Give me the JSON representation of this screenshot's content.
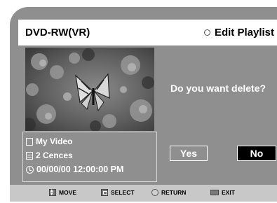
{
  "header": {
    "device": "DVD-RW(VR)",
    "title": "Edit Playlist"
  },
  "info": {
    "title": "My Video",
    "scenes": "2 Cences",
    "datetime": "00/00/00 12:00:00  PM"
  },
  "dialog": {
    "question": "Do you want delete?",
    "yes_label": "Yes",
    "no_label": "No"
  },
  "footer": {
    "move": "MOVE",
    "select": "SELECT",
    "return": "RETURN",
    "exit": "EXIT"
  },
  "icons": [
    "circle-icon",
    "title-icon",
    "scenes-icon",
    "clock-icon",
    "move-icon",
    "select-icon",
    "return-icon",
    "exit-icon"
  ],
  "colors": {
    "panel": "#8f8f8f",
    "header_bg": "#ffffff",
    "selected_button": "#000000",
    "footer_bg": "#c8c8c8"
  }
}
